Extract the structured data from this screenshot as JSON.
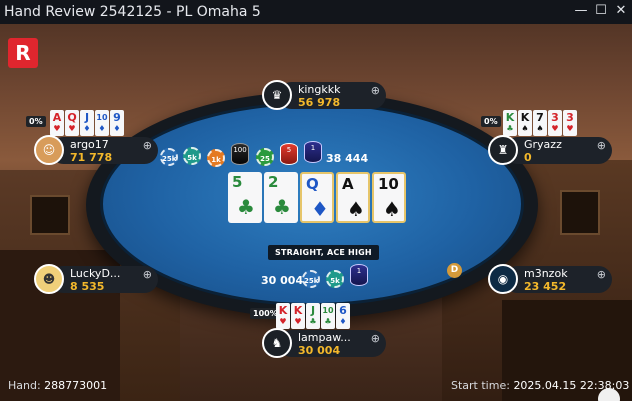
{
  "window": {
    "title": "Hand Review 2542125 - PL Omaha 5",
    "minimize": "—",
    "maximize": "☐",
    "close": "✕"
  },
  "brand": {
    "logo_letter": "R"
  },
  "players": {
    "top": {
      "name": "kingkkk",
      "stack": "56 978"
    },
    "left_top": {
      "name": "argo17",
      "stack": "71 778",
      "pct": "0%",
      "cards": [
        {
          "r": "A",
          "s": "♥",
          "c": "red"
        },
        {
          "r": "Q",
          "s": "♥",
          "c": "red"
        },
        {
          "r": "J",
          "s": "♦",
          "c": "blue"
        },
        {
          "r": "10",
          "s": "♦",
          "c": "blue"
        },
        {
          "r": "9",
          "s": "♦",
          "c": "blue"
        }
      ]
    },
    "right_top": {
      "name": "Gryazz",
      "stack": "0",
      "pct": "0%",
      "cards": [
        {
          "r": "K",
          "s": "♣",
          "c": "green"
        },
        {
          "r": "K",
          "s": "♠",
          "c": "black"
        },
        {
          "r": "7",
          "s": "♠",
          "c": "black"
        },
        {
          "r": "3",
          "s": "♥",
          "c": "red"
        },
        {
          "r": "3",
          "s": "♥",
          "c": "red"
        }
      ]
    },
    "left_bottom": {
      "name": "LuckyD...",
      "stack": "8 535"
    },
    "right_bottom": {
      "name": "m3nzok",
      "stack": "23 452"
    },
    "bottom": {
      "name": "lampaw...",
      "stack": "30 004",
      "pct": "100%",
      "cards": [
        {
          "r": "K",
          "s": "♥",
          "c": "red"
        },
        {
          "r": "K",
          "s": "♥",
          "c": "red"
        },
        {
          "r": "J",
          "s": "♣",
          "c": "green"
        },
        {
          "r": "10",
          "s": "♣",
          "c": "green"
        },
        {
          "r": "6",
          "s": "♦",
          "c": "blue"
        }
      ]
    }
  },
  "chips": {
    "c1": "25k",
    "c2": "5k",
    "c3": "1k",
    "c4": "100",
    "c5": "25",
    "c6": "5",
    "c7": "1",
    "bottom_c1": "25k",
    "bottom_c2": "5k",
    "bottom_c3": "1"
  },
  "pot": {
    "main": "38 444",
    "bet_bottom": "30 004"
  },
  "board": [
    {
      "r": "5",
      "s": "♣",
      "c": "green",
      "hl": false
    },
    {
      "r": "2",
      "s": "♣",
      "c": "green",
      "hl": false
    },
    {
      "r": "Q",
      "s": "♦",
      "c": "blue",
      "hl": true
    },
    {
      "r": "A",
      "s": "♠",
      "c": "black",
      "hl": true
    },
    {
      "r": "10",
      "s": "♠",
      "c": "black",
      "hl": true
    }
  ],
  "hand_label": "STRAIGHT, ACE HIGH",
  "dealer": "D",
  "footer": {
    "hand_label": "Hand: ",
    "hand_value": "288773001",
    "start_label": "Start time: ",
    "start_value": "2025.04.15 22:38:03"
  },
  "colors": {
    "felt": "#1f62a4",
    "stack_gold": "#f3b82b",
    "logo_red": "#e0262e"
  }
}
